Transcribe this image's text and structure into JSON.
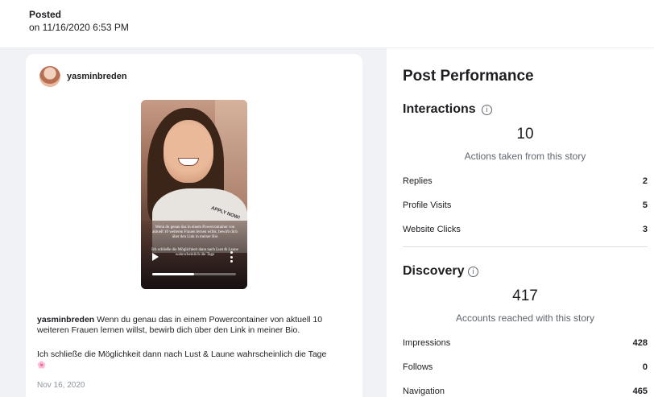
{
  "header": {
    "posted_label": "Posted",
    "posted_date": "on 11/16/2020 6:53 PM"
  },
  "post": {
    "username": "yasminbreden",
    "story_sticker": "APPLY NOW!",
    "story_text_1": "Wenn du genau das in einem Powercontainer von aktuell 10 weiteren Frauen lernen willst, bewirb dich über den Link in meiner Bio",
    "story_text_2": "Ich schließe die Möglichkeit dann nach Lust & Laune wahrscheinlich die Tage",
    "video_progress": 0.5,
    "caption_username": "yasminbreden",
    "caption_text": " Wenn du genau das in einem Powercontainer von aktuell 10 weiteren Frauen lernen willst, bewirb dich über den Link in meiner Bio.",
    "caption_text_2": "Ich schließe die Möglichkeit dann nach Lust & Laune wahrscheinlich die Tage",
    "emoji": "🌸",
    "date": "Nov 16, 2020"
  },
  "performance": {
    "title": "Post Performance",
    "interactions": {
      "title": "Interactions",
      "info_icon": "info-icon",
      "total": "10",
      "subtitle": "Actions taken from this story",
      "metrics": [
        {
          "label": "Replies",
          "value": "2"
        },
        {
          "label": "Profile Visits",
          "value": "5"
        },
        {
          "label": "Website Clicks",
          "value": "3"
        }
      ]
    },
    "discovery": {
      "title": "Discovery",
      "info_icon": "info-icon",
      "total": "417",
      "subtitle": "Accounts reached with this story",
      "metrics": [
        {
          "label": "Impressions",
          "value": "428"
        },
        {
          "label": "Follows",
          "value": "0"
        },
        {
          "label": "Navigation",
          "value": "465"
        }
      ]
    }
  }
}
